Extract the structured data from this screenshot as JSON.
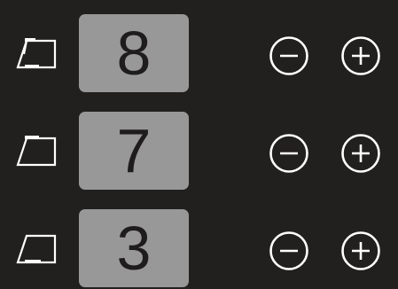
{
  "colors": {
    "background": "#221f1f",
    "value_box": "#999898",
    "value_text": "#1e1c1c",
    "icon_stroke": "#ffffff"
  },
  "zones": [
    {
      "value": "8",
      "icon": "heating-zone-front-icon",
      "minus_icon": "minus-circle-icon",
      "plus_icon": "plus-circle-icon"
    },
    {
      "value": "7",
      "icon": "heating-zone-middle-icon",
      "minus_icon": "minus-circle-icon",
      "plus_icon": "plus-circle-icon"
    },
    {
      "value": "3",
      "icon": "heating-zone-rear-icon",
      "minus_icon": "minus-circle-icon",
      "plus_icon": "plus-circle-icon"
    }
  ]
}
